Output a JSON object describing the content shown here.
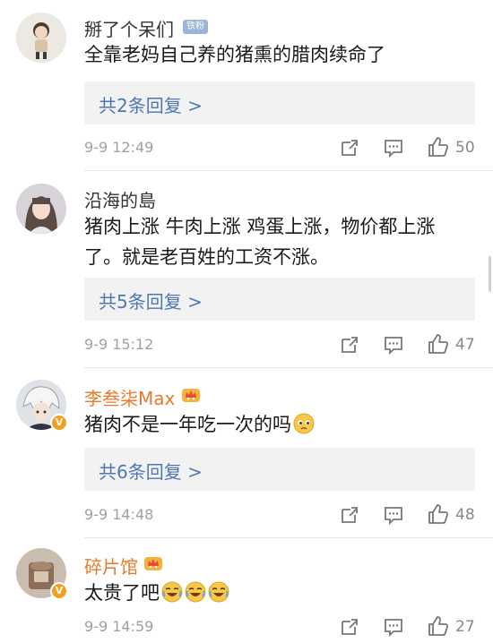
{
  "comments": [
    {
      "username": "掰了个呆们",
      "badge": "铁粉",
      "text": "全靠老妈自己养的猪熏的腊肉续命了",
      "reply_label": "共2条回复 >",
      "time": "9-9 12:49",
      "likes": "50",
      "avatar_icon": "cartoon-boy-avatar"
    },
    {
      "username": "沿海的島",
      "text_line1": "猪肉上涨 牛肉上涨 鸡蛋上涨，物价都上涨",
      "text_line2": "了。就是老百姓的工资不涨。",
      "reply_label": "共5条回复 >",
      "time": "9-9 15:12",
      "likes": "47",
      "avatar_icon": "girl-photo-avatar"
    },
    {
      "username": "李叁柒Max",
      "text": "猪肉不是一年吃一次的吗",
      "emoji": "pleading-face-emoji",
      "reply_label": "共6条回复 >",
      "time": "9-9 14:48",
      "likes": "48",
      "avatar_icon": "anime-character-avatar",
      "verified": "V"
    },
    {
      "username": "碎片馆",
      "text": "太贵了吧",
      "emoji": "laughing-crying-emoji",
      "time": "9-9 14:59",
      "likes": "27",
      "avatar_icon": "photo-avatar",
      "verified": "V"
    }
  ],
  "colors": {
    "link_blue": "#4f78b3",
    "vip_orange": "#e8792b",
    "meta_gray": "#a0a0a0",
    "reply_bg": "#f2f2f2"
  }
}
